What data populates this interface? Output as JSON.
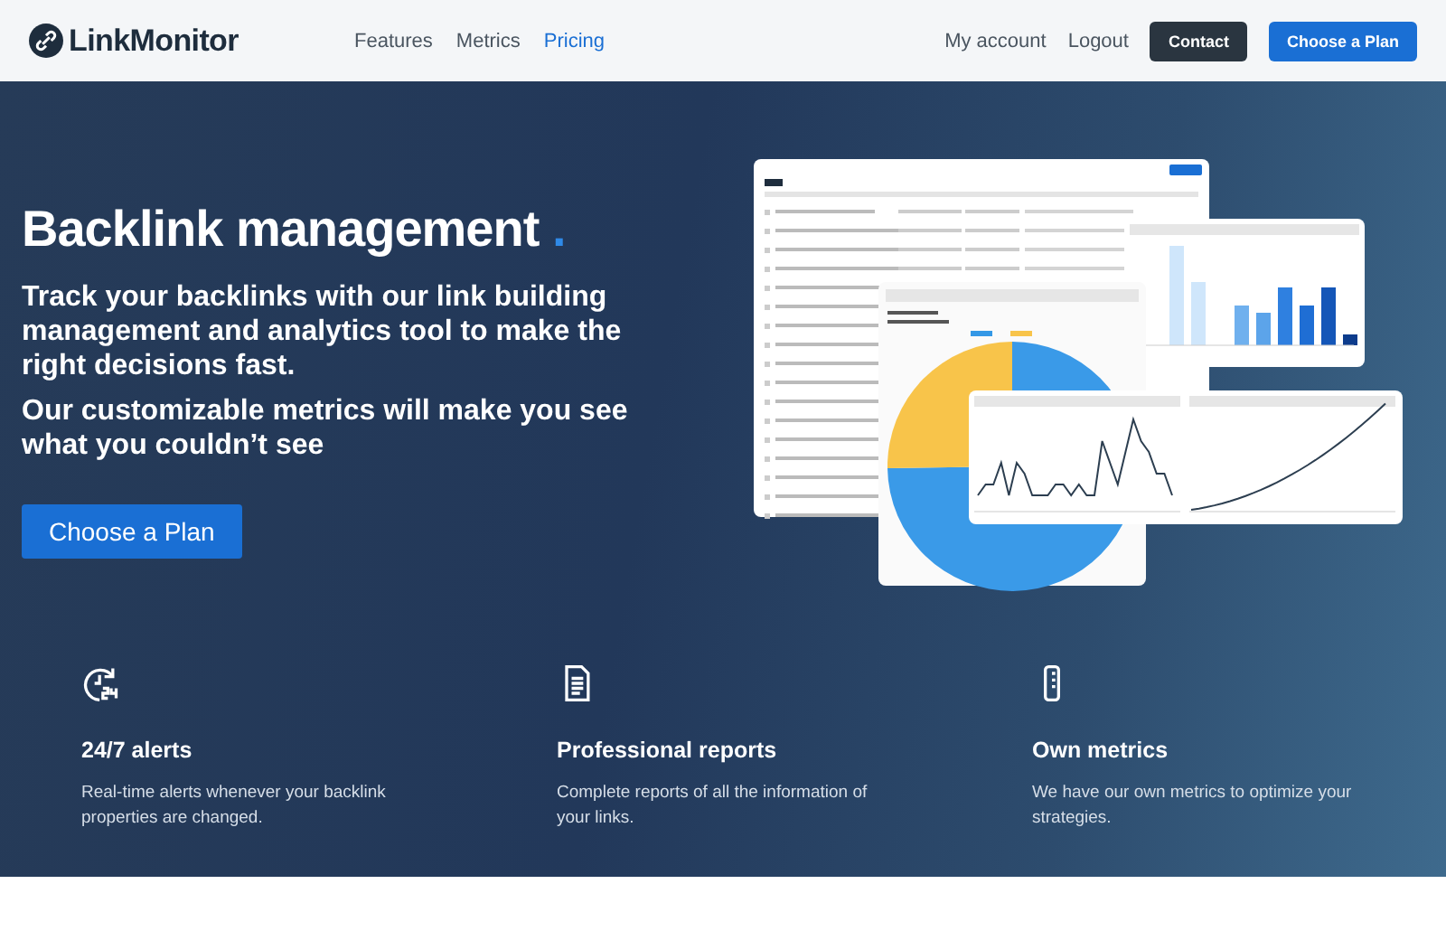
{
  "header": {
    "logo": "LinkMonitor",
    "nav": [
      {
        "label": "Features",
        "selected": false
      },
      {
        "label": "Metrics",
        "selected": false
      },
      {
        "label": "Pricing",
        "selected": true
      }
    ],
    "account_links": [
      "My account",
      "Logout"
    ],
    "buttons": [
      {
        "label": "Contact",
        "kind": "dark"
      },
      {
        "label": "Choose a Plan",
        "kind": "primary"
      }
    ]
  },
  "hero": {
    "title": "Backlink management",
    "title_accent": ".",
    "subtitle": "Track your backlinks with our link building management and analytics tool to make the right decisions fast.",
    "tagline": "Our customizable metrics will make you see what you couldn’t see",
    "cta": "Choose a Plan"
  },
  "features": [
    {
      "title": "24/7 alerts",
      "text": "Real-time alerts whenever your backlink properties are changed."
    },
    {
      "title": "Professional reports",
      "text": "Complete reports of all the information of your links."
    },
    {
      "title": "Own metrics",
      "text": "We have our own metrics to optimize your strategies."
    }
  ]
}
